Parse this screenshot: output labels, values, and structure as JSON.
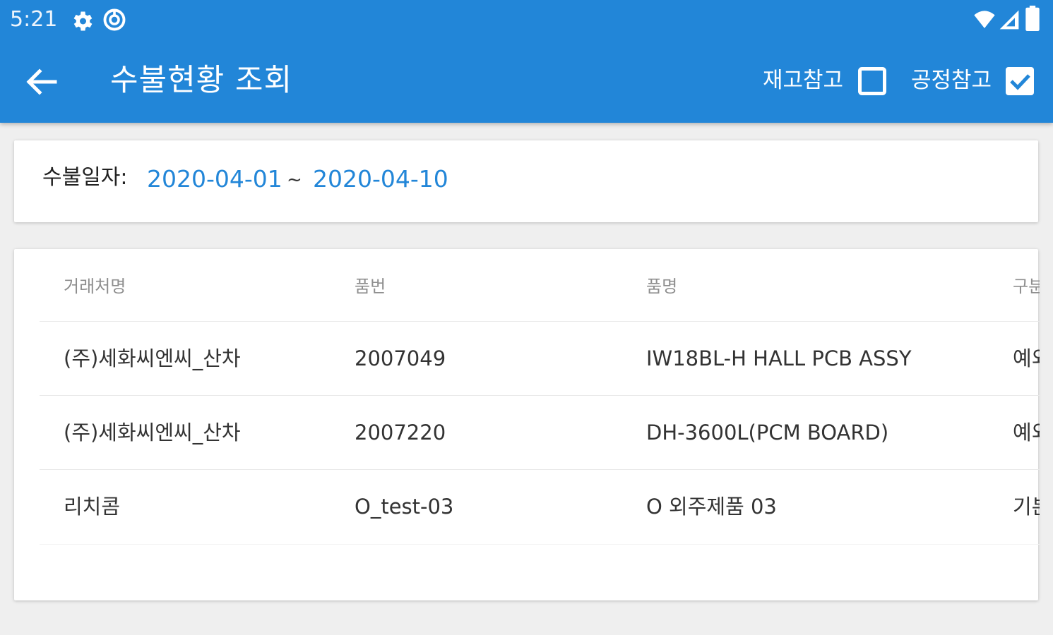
{
  "status_bar": {
    "time": "5:21",
    "left_icons": [
      "gear-icon",
      "sync-icon"
    ],
    "right_icons": [
      "wifi-icon",
      "signal-icon",
      "battery-icon"
    ]
  },
  "app_bar": {
    "title": "수불현황 조회",
    "back_icon": "arrow-back-icon",
    "actions": [
      {
        "label": "재고참고",
        "checked": false
      },
      {
        "label": "공정참고",
        "checked": true
      }
    ]
  },
  "date_filter": {
    "label": "수불일자:",
    "start": "2020-04-01",
    "separator": "~",
    "end": "2020-04-10"
  },
  "table": {
    "headers": [
      "거래처명",
      "품번",
      "품명",
      "구분"
    ],
    "rows": [
      [
        "(주)세화씨엔씨_산차",
        "2007049",
        "IW18BL-H HALL PCB ASSY",
        "예외"
      ],
      [
        "(주)세화씨엔씨_산차",
        "2007220",
        "DH-3600L(PCM BOARD)",
        "예외"
      ],
      [
        "리치콤",
        "O_test-03",
        "O 외주제품 03",
        "기본"
      ]
    ]
  },
  "colors": {
    "primary": "#2286d8",
    "background": "#efefef",
    "card": "#ffffff",
    "header_text": "#8e8e8e",
    "body_text": "#333333"
  }
}
